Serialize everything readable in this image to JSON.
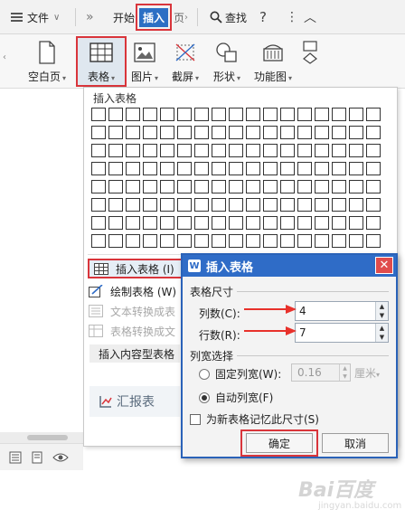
{
  "titlebar": {
    "file_label": "文件",
    "more_label": "»",
    "start_label": "开始",
    "insert_label": "插入",
    "page_label": "页",
    "find_label": "查找",
    "help_label": "?",
    "options_label": "⋮",
    "collapse_label": "︿"
  },
  "ribbon": {
    "buttons": [
      {
        "label": "空白页"
      },
      {
        "label": "表格"
      },
      {
        "label": "图片"
      },
      {
        "label": "截屏"
      },
      {
        "label": "形状"
      },
      {
        "label": "功能图"
      }
    ]
  },
  "dropdown": {
    "header": "插入表格",
    "grid_cols": 17,
    "grid_rows": 8,
    "items": [
      {
        "label": "插入表格 (I)",
        "enabled": true
      },
      {
        "label": "绘制表格 (W)",
        "enabled": true
      },
      {
        "label": "文本转换成表",
        "enabled": false
      },
      {
        "label": "表格转换成文",
        "enabled": false
      }
    ],
    "content_table_label": "插入内容型表格",
    "report_label": "汇报表"
  },
  "dialog": {
    "title": "插入表格",
    "close_label": "✕",
    "size_group": "表格尺寸",
    "cols_label": "列数(C):",
    "cols_value": "4",
    "rows_label": "行数(R):",
    "rows_value": "7",
    "width_group": "列宽选择",
    "fixed_width_label": "固定列宽(W):",
    "fixed_width_value": "0.16",
    "unit_label": "厘米",
    "auto_width_label": "自动列宽(F)",
    "remember_label": "为新表格记忆此尺寸(S)",
    "ok_label": "确定",
    "cancel_label": "取消"
  },
  "watermark": {
    "text": "Bai百度",
    "sub": "jingyan.baidu.com"
  },
  "colors": {
    "accent_blue": "#2f6cc7",
    "highlight_red": "#d9353b"
  }
}
